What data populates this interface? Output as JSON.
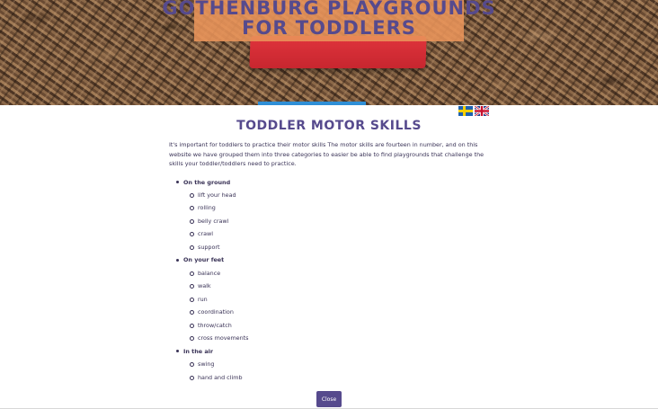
{
  "hero": {
    "title_line1": "Gothenburg Playgrounds",
    "title_line2": "for Toddlers"
  },
  "languages": [
    {
      "code": "sv",
      "flag_icon": "sweden-flag-icon"
    },
    {
      "code": "en",
      "flag_icon": "uk-flag-icon"
    }
  ],
  "section_title": "Toddler Motor Skills",
  "intro": "It's important for toddlers to practice their motor skills The motor skills are fourteen in number, and on this website we have grouped them into three categories to easier be able to find playgrounds that challenge the skills your toddler/toddlers need to practice.",
  "groups": [
    {
      "label": "On the ground",
      "items": [
        "lift your head",
        "rolling",
        "belly crawl",
        "crawl",
        "support"
      ]
    },
    {
      "label": "On your feet",
      "items": [
        "balance",
        "walk",
        "run",
        "coordination",
        "throw/catch",
        "cross movements"
      ]
    },
    {
      "label": "In the air",
      "items": [
        "swing",
        "hand and climb"
      ]
    }
  ],
  "close_label": "Close",
  "colors": {
    "accent": "#564a8d",
    "title_plate": "#e9945a",
    "block": "#d22d36"
  }
}
